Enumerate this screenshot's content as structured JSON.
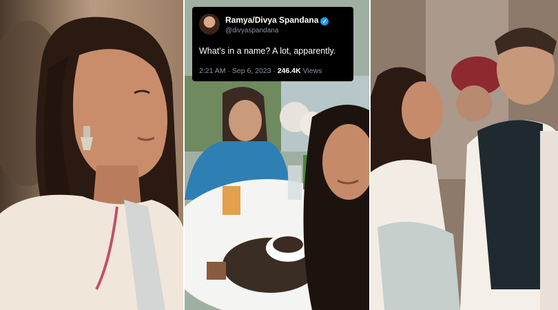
{
  "tweet": {
    "display_name": "Ramya/Divya Spandana",
    "verified_icon": "check",
    "handle": "@divyaspandana",
    "text": "What’s in a name? A lot, apparently.",
    "time": "2:21 AM · Sep 6, 2023 · ",
    "views_count": "246.4K",
    "views_label": " Views"
  },
  "colors": {
    "tweet_bg": "#000000",
    "badge": "#1d9bf0",
    "meta": "#8b98a5"
  }
}
